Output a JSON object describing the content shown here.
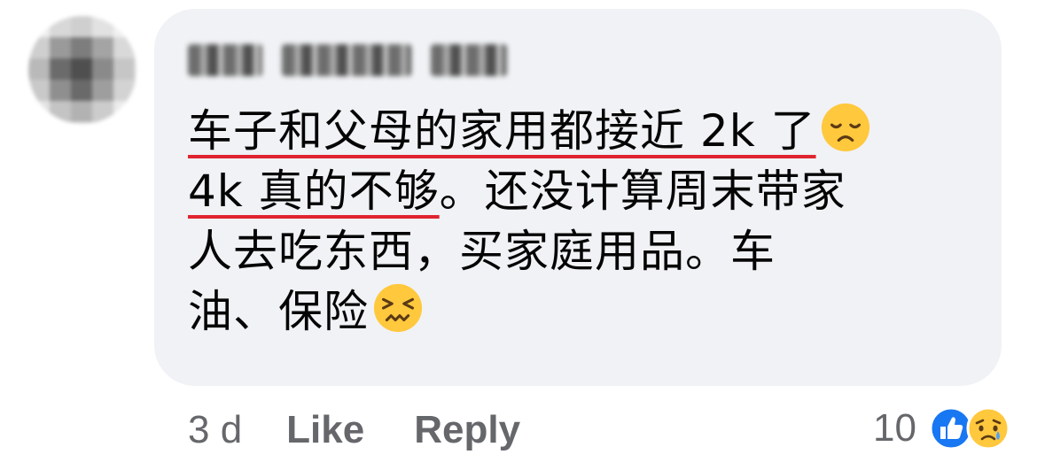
{
  "comment": {
    "author": {
      "name": "",
      "avatar_icon": "avatar-blurred"
    },
    "lines": [
      {
        "underlined": "车子和父母的家用都接近 2k 了",
        "emoji": "disappointed-face"
      },
      {
        "underlined": "4k 真的不够",
        "rest": "。还没计算周末带家"
      },
      {
        "text": "人去吃东西，买家庭用品。车"
      },
      {
        "text": "油、保险",
        "emoji": "confounded-face"
      }
    ]
  },
  "actions": {
    "timestamp": "3 d",
    "like_label": "Like",
    "reply_label": "Reply"
  },
  "reactions": {
    "count": "10",
    "icons": [
      "like-reaction-icon",
      "sad-reaction-icon"
    ]
  },
  "colors": {
    "bubble": "#f0f2f5",
    "text": "#050505",
    "meta": "#65676b",
    "underline": "#e0242f",
    "like_blue": "#1877f2",
    "emoji_yellow": "#ffc83d"
  }
}
